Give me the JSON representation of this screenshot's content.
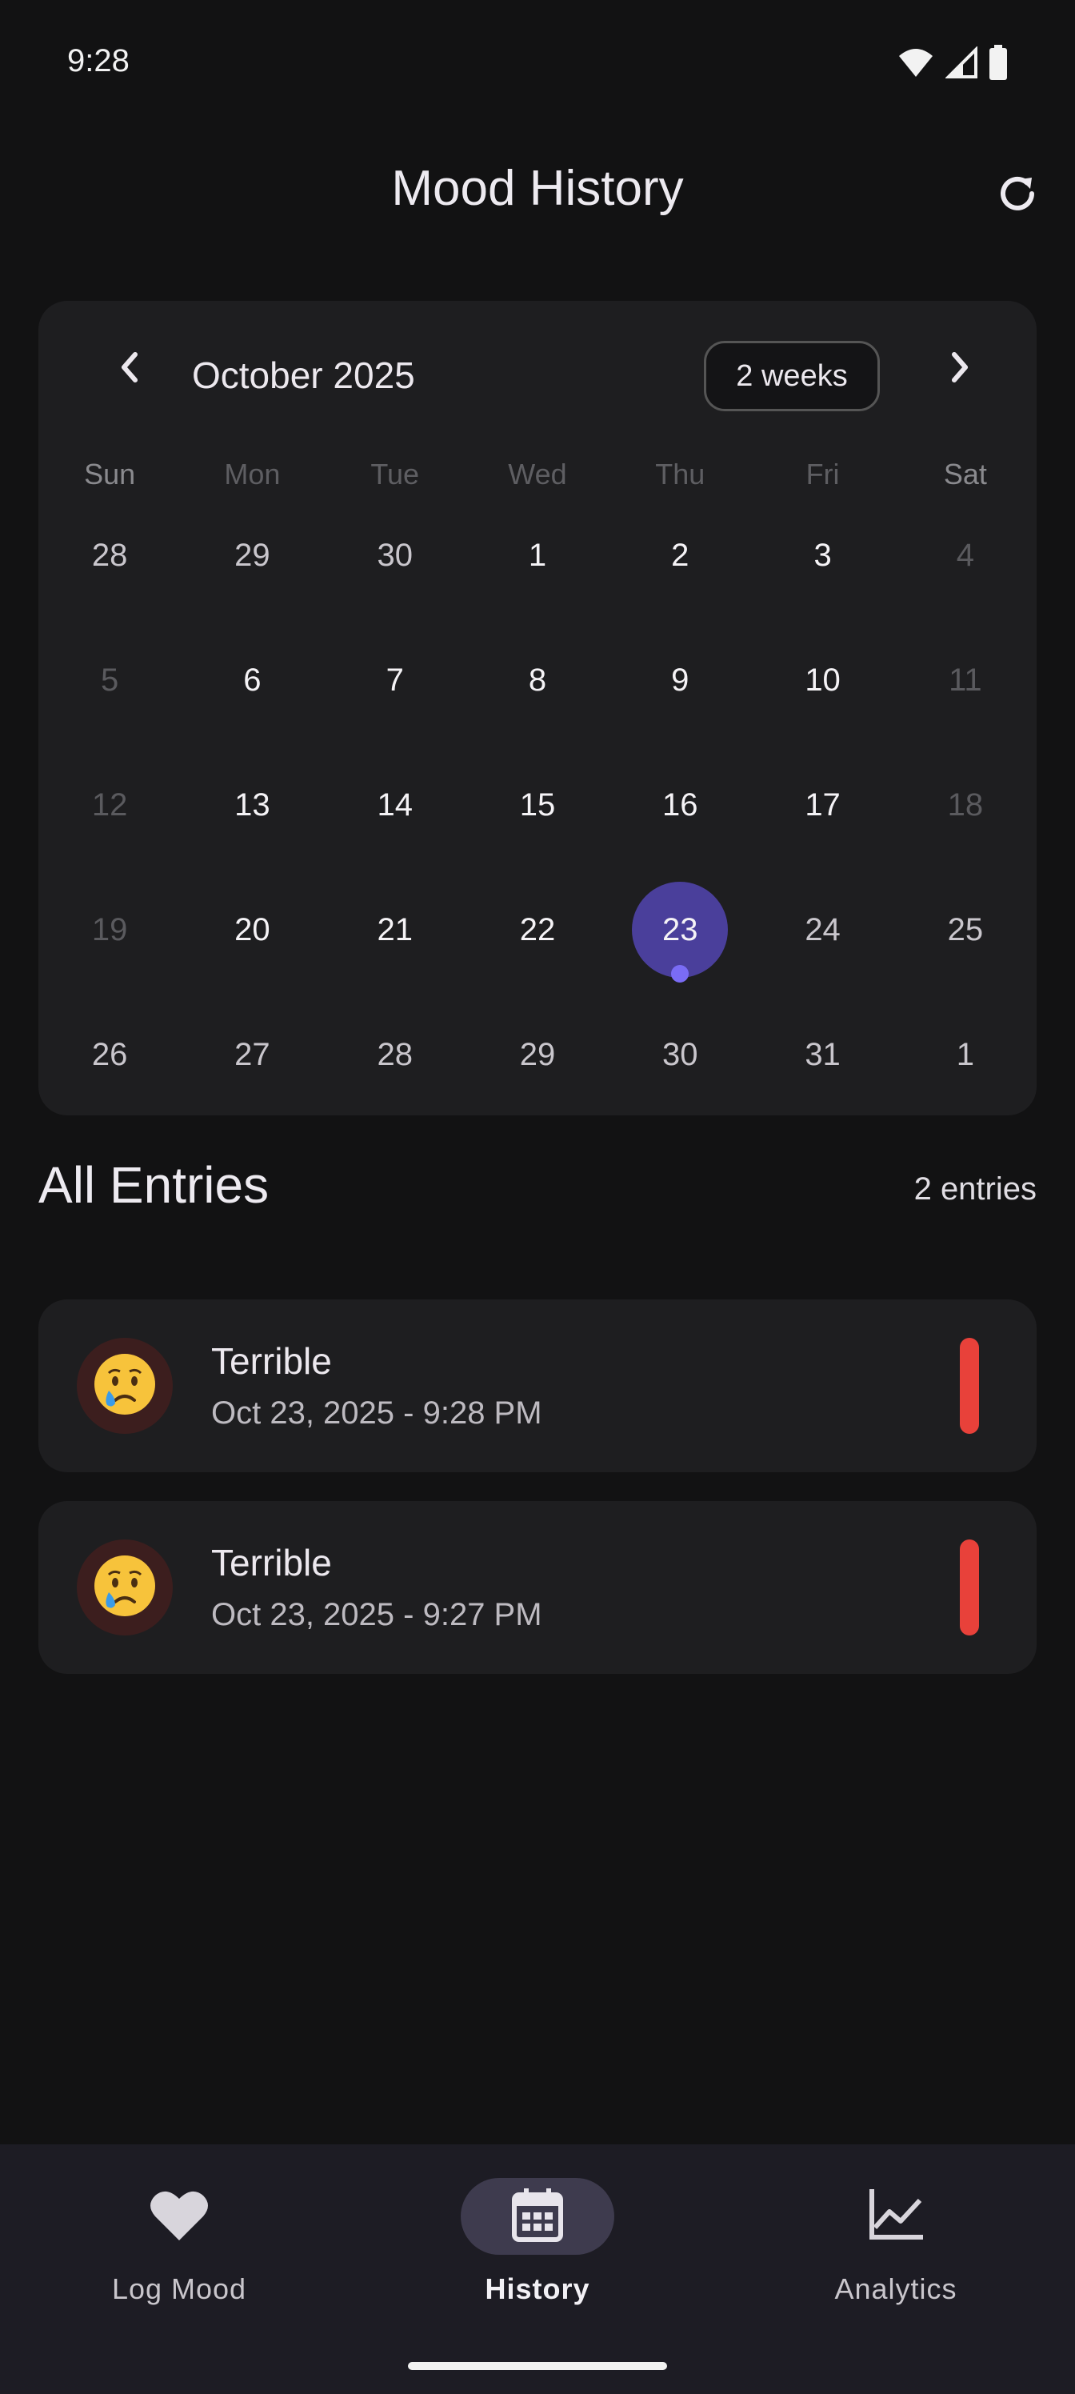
{
  "status_bar": {
    "time": "9:28"
  },
  "app_bar": {
    "title": "Mood History",
    "refresh_icon": "refresh-icon"
  },
  "calendar": {
    "month_label": "October 2025",
    "format_button": "2 weeks",
    "weekdays": [
      "Sun",
      "Mon",
      "Tue",
      "Wed",
      "Thu",
      "Fri",
      "Sat"
    ],
    "weeks": [
      [
        "28",
        "29",
        "30",
        "1",
        "2",
        "3",
        "4"
      ],
      [
        "5",
        "6",
        "7",
        "8",
        "9",
        "10",
        "11"
      ],
      [
        "12",
        "13",
        "14",
        "15",
        "16",
        "17",
        "18"
      ],
      [
        "19",
        "20",
        "21",
        "22",
        "23",
        "24",
        "25"
      ],
      [
        "26",
        "27",
        "28",
        "29",
        "30",
        "31",
        "1"
      ]
    ],
    "selected_day": "23",
    "selected_color": "#4A3F9B",
    "marker_color": "#7A6CF5"
  },
  "entries": {
    "title": "All Entries",
    "count_label": "2 entries",
    "items": [
      {
        "emoji": "😢",
        "mood": "Terrible",
        "datetime": "Oct 23, 2025 - 9:28 PM",
        "color": "#E8413A"
      },
      {
        "emoji": "😢",
        "mood": "Terrible",
        "datetime": "Oct 23, 2025 - 9:27 PM",
        "color": "#E8413A"
      }
    ]
  },
  "bottom_nav": {
    "items": [
      {
        "label": "Log Mood",
        "icon": "heart-icon"
      },
      {
        "label": "History",
        "icon": "calendar-icon"
      },
      {
        "label": "Analytics",
        "icon": "chart-icon"
      }
    ],
    "active": "History"
  }
}
